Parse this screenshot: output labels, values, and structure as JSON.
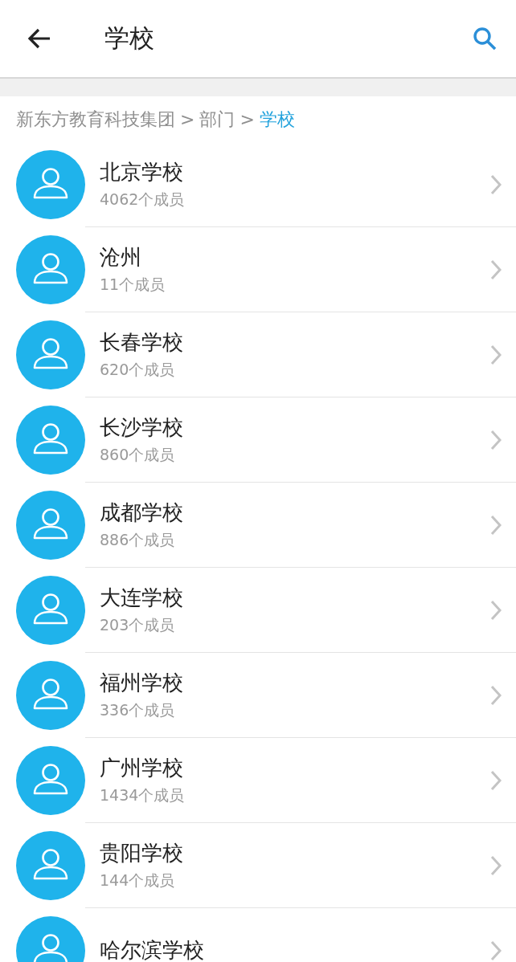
{
  "header": {
    "title": "学校"
  },
  "breadcrumb": [
    {
      "text": "新东方教育科技集团",
      "kind": "crumb",
      "selected": false
    },
    {
      "text": ">",
      "kind": "separator"
    },
    {
      "text": "部门",
      "kind": "crumb",
      "selected": false
    },
    {
      "text": ">",
      "kind": "separator"
    },
    {
      "text": "学校",
      "kind": "crumb",
      "selected": true
    }
  ],
  "rows": [
    {
      "name": "北京学校",
      "members": "4062个成员"
    },
    {
      "name": "沧州",
      "members": "11个成员"
    },
    {
      "name": "长春学校",
      "members": "620个成员"
    },
    {
      "name": "长沙学校",
      "members": "860个成员"
    },
    {
      "name": "成都学校",
      "members": "886个成员"
    },
    {
      "name": "大连学校",
      "members": "203个成员"
    },
    {
      "name": "福州学校",
      "members": "336个成员"
    },
    {
      "name": "广州学校",
      "members": "1434个成员"
    },
    {
      "name": "贵阳学校",
      "members": "144个成员"
    },
    {
      "name": "哈尔滨学校"
    }
  ]
}
